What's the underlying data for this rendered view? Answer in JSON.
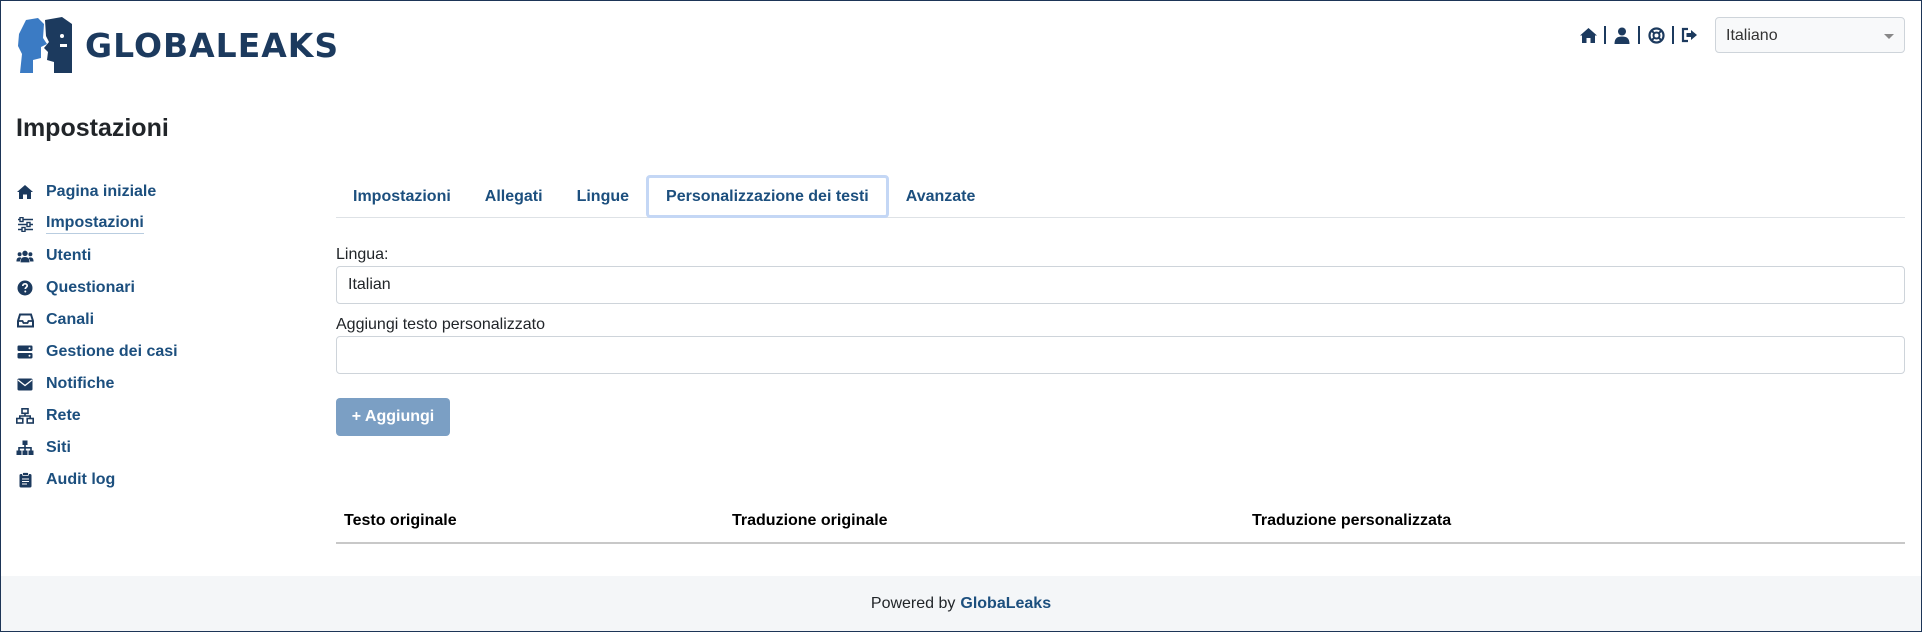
{
  "app": {
    "name": "GLOBALEAKS"
  },
  "header": {
    "icons": [
      "home-icon",
      "user-icon",
      "help-icon",
      "logout-icon"
    ],
    "language": "Italiano"
  },
  "page": {
    "title": "Impostazioni"
  },
  "sidebar": {
    "items": [
      {
        "label": "Pagina iniziale",
        "icon": "home-icon"
      },
      {
        "label": "Impostazioni",
        "icon": "sliders-icon",
        "active": true
      },
      {
        "label": "Utenti",
        "icon": "users-icon"
      },
      {
        "label": "Questionari",
        "icon": "question-icon"
      },
      {
        "label": "Canali",
        "icon": "inbox-icon"
      },
      {
        "label": "Gestione dei casi",
        "icon": "server-icon"
      },
      {
        "label": "Notifiche",
        "icon": "envelope-icon"
      },
      {
        "label": "Rete",
        "icon": "network-icon"
      },
      {
        "label": "Siti",
        "icon": "sitemap-icon"
      },
      {
        "label": "Audit log",
        "icon": "clipboard-icon"
      }
    ]
  },
  "tabs": [
    {
      "label": "Impostazioni"
    },
    {
      "label": "Allegati"
    },
    {
      "label": "Lingue"
    },
    {
      "label": "Personalizzazione dei testi",
      "active": true
    },
    {
      "label": "Avanzate"
    }
  ],
  "form": {
    "language_label": "Lingua:",
    "language_value": "Italian",
    "custom_text_label": "Aggiungi testo personalizzato",
    "custom_text_value": "",
    "add_button": "+ Aggiungi"
  },
  "table": {
    "columns": [
      "Testo originale",
      "Traduzione originale",
      "Traduzione personalizzata"
    ]
  },
  "footer": {
    "prefix": "Powered by",
    "brand": "GlobaLeaks"
  },
  "colors": {
    "primary": "#1c4f7e",
    "logo_blue": "#3b7bc4",
    "logo_dark": "#1c3a5e",
    "button": "#7b9fc4"
  }
}
